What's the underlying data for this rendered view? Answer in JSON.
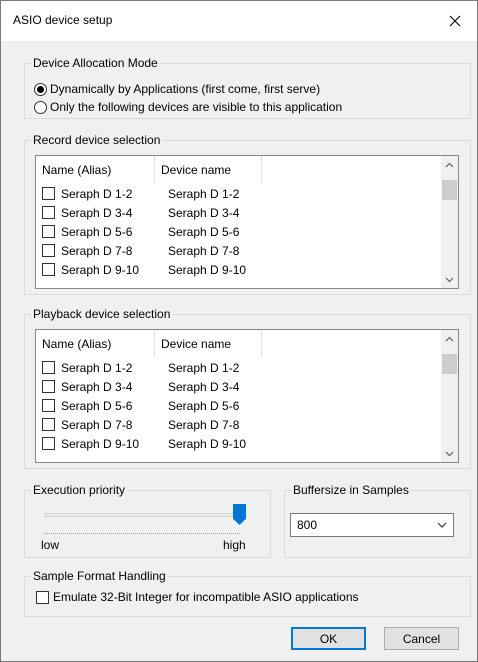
{
  "window": {
    "title": "ASIO device setup"
  },
  "allocation": {
    "legend": "Device Allocation Mode",
    "options": [
      {
        "label": "Dynamically by Applications (first come, first serve)",
        "checked": true
      },
      {
        "label": "Only the following devices are visible to this application",
        "checked": false
      }
    ]
  },
  "record": {
    "legend": "Record device selection",
    "columns": [
      "Name (Alias)",
      "Device name"
    ],
    "rows": [
      {
        "alias": "Seraph D 1-2",
        "name": "Seraph D 1-2",
        "checked": false
      },
      {
        "alias": "Seraph D 3-4",
        "name": "Seraph D 3-4",
        "checked": false
      },
      {
        "alias": "Seraph D 5-6",
        "name": "Seraph D 5-6",
        "checked": false
      },
      {
        "alias": "Seraph D 7-8",
        "name": "Seraph D 7-8",
        "checked": false
      },
      {
        "alias": "Seraph D 9-10",
        "name": "Seraph D 9-10",
        "checked": false
      }
    ]
  },
  "playback": {
    "legend": "Playback device selection",
    "columns": [
      "Name (Alias)",
      "Device name"
    ],
    "rows": [
      {
        "alias": "Seraph D 1-2",
        "name": "Seraph D 1-2",
        "checked": false
      },
      {
        "alias": "Seraph D 3-4",
        "name": "Seraph D 3-4",
        "checked": false
      },
      {
        "alias": "Seraph D 5-6",
        "name": "Seraph D 5-6",
        "checked": false
      },
      {
        "alias": "Seraph D 7-8",
        "name": "Seraph D 7-8",
        "checked": false
      },
      {
        "alias": "Seraph D 9-10",
        "name": "Seraph D 9-10",
        "checked": false
      }
    ]
  },
  "priority": {
    "legend": "Execution priority",
    "low": "low",
    "high": "high",
    "level": 1.0
  },
  "buffer": {
    "legend": "Buffersize in Samples",
    "value": "800"
  },
  "format": {
    "legend": "Sample Format Handling",
    "checkbox_label": "Emulate 32-Bit Integer for incompatible ASIO applications",
    "checked": false
  },
  "buttons": {
    "ok": "OK",
    "cancel": "Cancel"
  },
  "icons": {
    "close": "close-icon",
    "scroll_up": "chevron-up-icon",
    "scroll_down": "chevron-down-icon",
    "dropdown": "chevron-down-icon"
  },
  "colors": {
    "accent": "#0078d7",
    "background": "#f0f0f0"
  }
}
